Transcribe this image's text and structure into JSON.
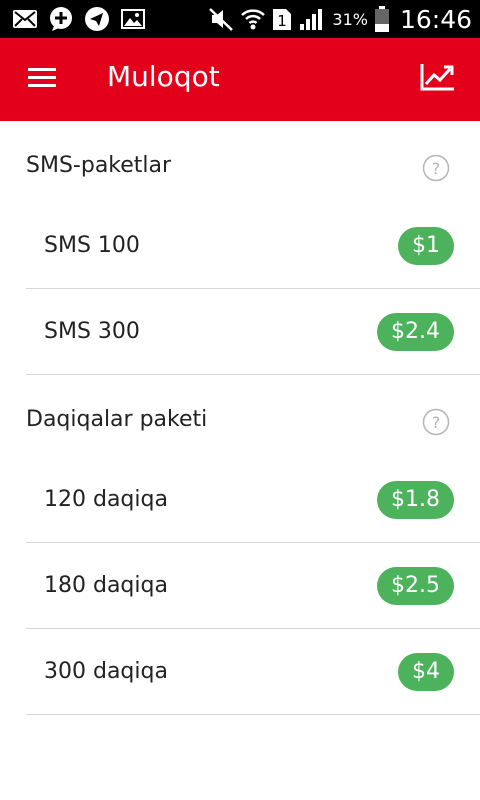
{
  "status_bar": {
    "battery_percent": "31%",
    "time": "16:46",
    "sim_slot": "1",
    "icons": [
      "email-icon",
      "add-message-icon",
      "telegram-icon",
      "gallery-icon",
      "mute-icon",
      "wifi-icon",
      "sim-icon",
      "signal-icon",
      "battery-icon"
    ]
  },
  "app_bar": {
    "title": "Muloqot",
    "color": "#e3001b"
  },
  "sections": [
    {
      "title": "SMS-paketlar",
      "items": [
        {
          "label": "SMS 100",
          "price": "$1"
        },
        {
          "label": "SMS 300",
          "price": "$2.4"
        }
      ]
    },
    {
      "title": "Daqiqalar paketi",
      "items": [
        {
          "label": "120 daqiqa",
          "price": "$1.8"
        },
        {
          "label": "180 daqiqa",
          "price": "$2.5"
        },
        {
          "label": "300 daqiqa",
          "price": "$4"
        }
      ]
    }
  ],
  "badge_color": "#4cb25c"
}
